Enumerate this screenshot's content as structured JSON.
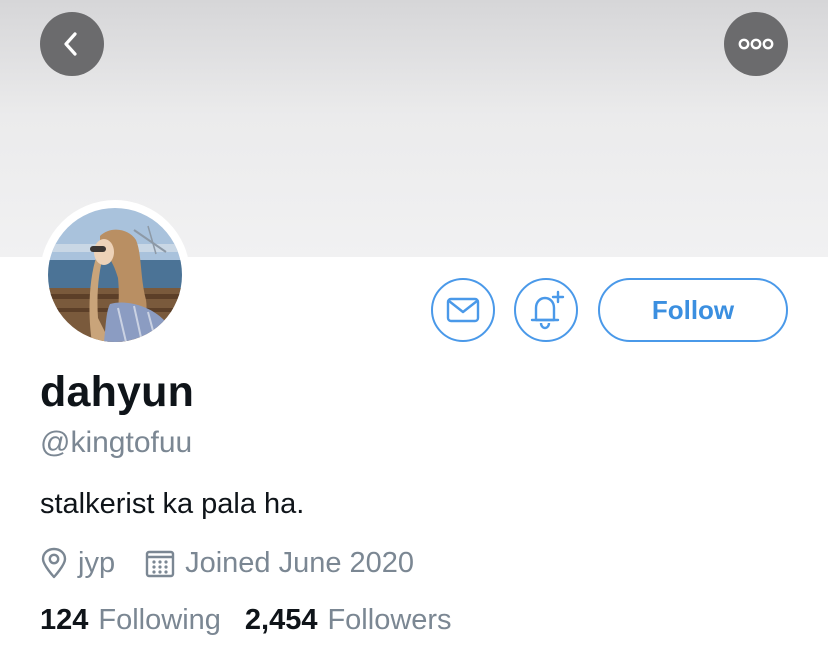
{
  "profile": {
    "display_name": "dahyun",
    "handle": "@kingtofuu",
    "bio": "stalkerist ka pala ha.",
    "location": "jyp",
    "joined": "Joined June 2020"
  },
  "actions": {
    "follow_label": "Follow"
  },
  "stats": {
    "following_count": "124",
    "following_label": "Following",
    "followers_count": "2,454",
    "followers_label": "Followers"
  },
  "icons": {
    "back": "chevron-left-icon",
    "more": "more-icon",
    "message": "envelope-icon",
    "notify": "bell-plus-icon",
    "location": "location-pin-icon",
    "calendar": "calendar-icon"
  },
  "colors": {
    "accent": "#4a99e9",
    "text": "#0f1419",
    "muted": "#7b8793",
    "nav_button": "#6b6b6d"
  }
}
